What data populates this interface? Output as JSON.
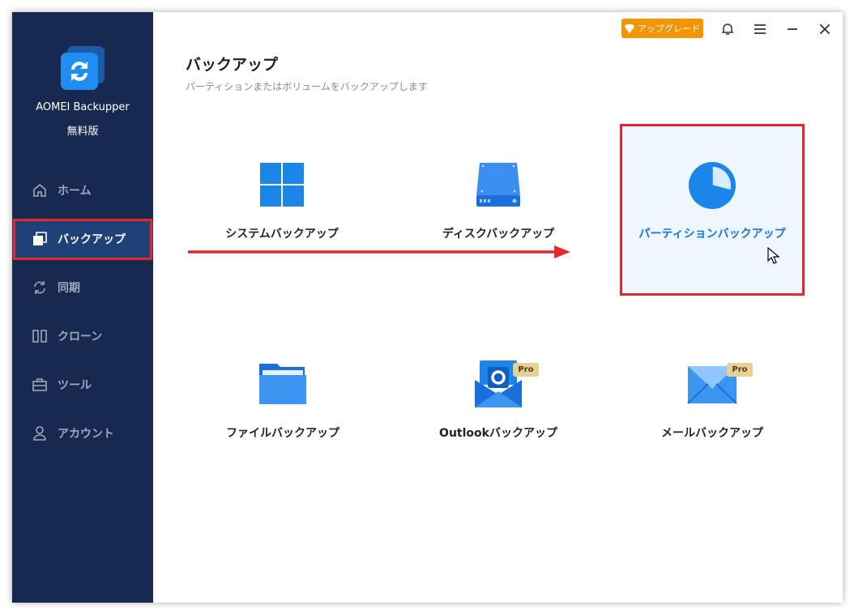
{
  "app": {
    "name": "AOMEI Backupper",
    "edition": "無料版"
  },
  "sidebar": {
    "items": [
      {
        "label": "ホーム",
        "icon": "home-icon"
      },
      {
        "label": "バックアップ",
        "icon": "backup-icon",
        "active": true
      },
      {
        "label": "同期",
        "icon": "sync-icon"
      },
      {
        "label": "クローン",
        "icon": "clone-icon"
      },
      {
        "label": "ツール",
        "icon": "tools-icon"
      },
      {
        "label": "アカウント",
        "icon": "account-icon"
      }
    ]
  },
  "topbar": {
    "upgrade_label": "アップグレード"
  },
  "page": {
    "title": "バックアップ",
    "subtitle": "パーティションまたはボリュームをバックアップします"
  },
  "options": [
    {
      "label": "システムバックアップ",
      "icon": "windows-icon"
    },
    {
      "label": "ディスクバックアップ",
      "icon": "disk-icon"
    },
    {
      "label": "パーティションバックアップ",
      "icon": "pie-chart-icon",
      "selected": true
    },
    {
      "label": "ファイルバックアップ",
      "icon": "folder-icon"
    },
    {
      "label": "Outlookバックアップ",
      "icon": "outlook-icon",
      "badge": "Pro"
    },
    {
      "label": "メールバックアップ",
      "icon": "mail-icon",
      "badge": "Pro"
    }
  ],
  "colors": {
    "sidebar_bg": "#17294f",
    "accent": "#1577e0",
    "highlight_border": "#e4262f",
    "upgrade": "#f29500"
  }
}
